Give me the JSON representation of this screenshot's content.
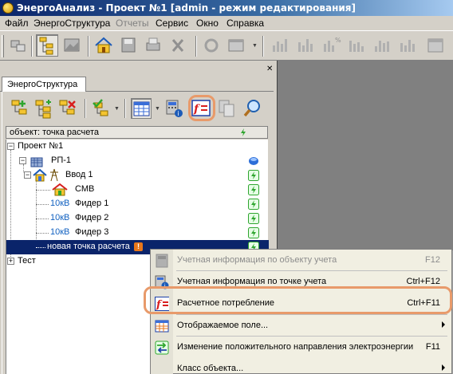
{
  "window": {
    "title": "ЭнергоАнализ - Проект №1 [admin - режим редактирования]"
  },
  "menu": {
    "items": [
      {
        "label": "Файл",
        "disabled": false
      },
      {
        "label": "ЭнергоСтруктура",
        "disabled": false
      },
      {
        "label": "Отчеты",
        "disabled": true
      },
      {
        "label": "Сервис",
        "disabled": false
      },
      {
        "label": "Окно",
        "disabled": false
      },
      {
        "label": "Справка",
        "disabled": false
      }
    ]
  },
  "panel": {
    "tab_label": "ЭнергоСтруктура",
    "header_label": "объект: точка расчета"
  },
  "tree": {
    "items": [
      {
        "label": "Проект №1",
        "icon": "none"
      },
      {
        "label": "РП-1",
        "icon": "substation-icon"
      },
      {
        "label": "Ввод 1",
        "icon": "input-icon"
      },
      {
        "label": "СМВ",
        "icon": "house-icon"
      },
      {
        "prefix": "10кВ",
        "label": "Фидер 1"
      },
      {
        "prefix": "10кВ",
        "label": "Фидер 2"
      },
      {
        "prefix": "10кВ",
        "label": "Фидер 3"
      },
      {
        "label": "новая точка расчета",
        "badge": "!"
      },
      {
        "label": "Тест"
      }
    ]
  },
  "context_menu": {
    "items": [
      {
        "label": "Учетная информация по объекту учета",
        "shortcut": "F12",
        "disabled": true
      },
      {
        "label": "Учетная информация по точке учета",
        "shortcut": "Ctrl+F12",
        "disabled": false
      },
      {
        "label": "Расчетное потребление",
        "shortcut": "Ctrl+F11",
        "disabled": false
      },
      {
        "label": "Отображаемое поле...",
        "shortcut": "",
        "disabled": false
      },
      {
        "label": "Изменение положительного направления электроэнергии",
        "shortcut": "F11",
        "disabled": false
      },
      {
        "label": "Класс объекта...",
        "shortcut": "",
        "disabled": false
      }
    ]
  },
  "colors": {
    "selection": "#0a246a",
    "highlight_ring": "#e89a6a",
    "kv_text": "#1060c0",
    "status_green": "#2fa52f",
    "formula_red": "#d81e1e",
    "formula_blue": "#1c3fa8"
  }
}
